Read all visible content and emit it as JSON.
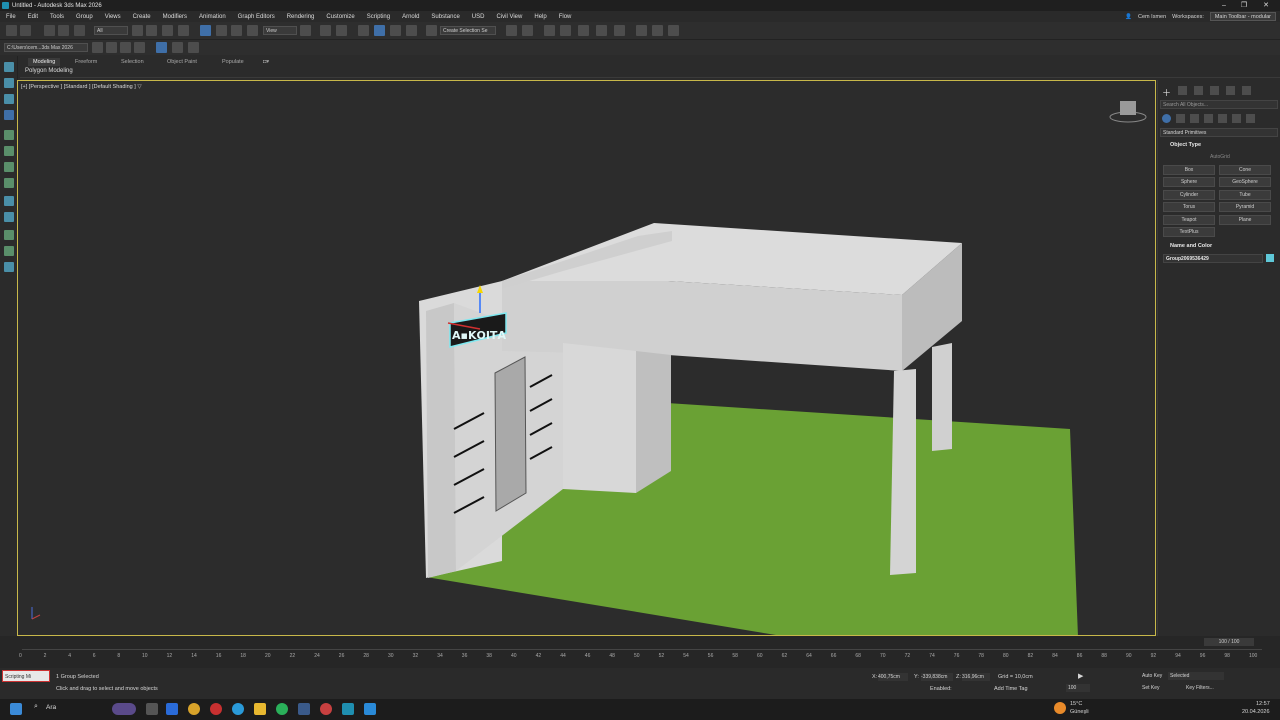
{
  "window": {
    "title": "Untitled - Autodesk 3ds Max 2026",
    "min": "–",
    "max": "❐",
    "close": "✕"
  },
  "menu": {
    "items": [
      "File",
      "Edit",
      "Tools",
      "Group",
      "Views",
      "Create",
      "Modifiers",
      "Animation",
      "Graph Editors",
      "Rendering",
      "Customize",
      "Scripting",
      "Arnold",
      "Substance",
      "USD",
      "Civil View",
      "Help",
      "Flow"
    ],
    "user": "Cem Ismen",
    "workspaces_label": "Workspaces:",
    "workspace_value": "Main Toolbar - modular"
  },
  "toolbar": {
    "filter_all": "All",
    "view_dropdown": "View",
    "selection_set": "Create Selection Se",
    "path": "C:\\Users\\cem...3ds Max 2026"
  },
  "ribbon": {
    "tabs": [
      "Modeling",
      "Freeform",
      "Selection",
      "Object Paint",
      "Populate"
    ],
    "sublabel": "Polygon Modeling"
  },
  "viewport": {
    "label": "[+] [Perspective ] [Standard ] [Default Shading ]",
    "filter_icon": "▽",
    "sign_text": "Α▪ΚΟΙΤΑ"
  },
  "command_panel": {
    "search_placeholder": "Search All Objects...",
    "category": "Standard Primitives",
    "object_type_header": "Object Type",
    "autogrid": "AutoGrid",
    "buttons": [
      "Box",
      "Cone",
      "Sphere",
      "GeoSphere",
      "Cylinder",
      "Tube",
      "Torus",
      "Pyramid",
      "Teapot",
      "Plane",
      "TextPlus"
    ],
    "name_color_header": "Name and Color",
    "object_name": "Group2069536429",
    "object_color": "#5fc8d8"
  },
  "timeline": {
    "frame_counter": "100 / 100",
    "ticks": [
      "0",
      "2",
      "4",
      "6",
      "8",
      "10",
      "12",
      "14",
      "16",
      "18",
      "20",
      "22",
      "24",
      "26",
      "28",
      "30",
      "32",
      "34",
      "36",
      "38",
      "40",
      "42",
      "44",
      "46",
      "48",
      "50",
      "52",
      "54",
      "56",
      "58",
      "60",
      "62",
      "64",
      "66",
      "68",
      "70",
      "72",
      "74",
      "76",
      "78",
      "80",
      "82",
      "84",
      "86",
      "88",
      "90",
      "92",
      "94",
      "96",
      "98",
      "100"
    ]
  },
  "status": {
    "maxscript": "Scripting Mi",
    "selected": "1 Group Selected",
    "prompt": "Click and drag to select and move objects",
    "x_label": "X:",
    "x_value": "400,75cm",
    "y_label": "Y:",
    "y_value": "-339,838cm",
    "z_label": "Z:",
    "z_value": "316,96cm",
    "grid": "Grid = 10,0cm",
    "enabled": "Enabled:",
    "add_time_tag": "Add Time Tag",
    "auto_key": "Auto Key",
    "set_key": "Set Key",
    "selected_dd": "Selected",
    "key_filters": "Key Filters...",
    "frame": "100"
  },
  "taskbar": {
    "search": "Ara",
    "weather_temp": "15°C",
    "weather_desc": "Güneşli",
    "time": "12:57",
    "date": "20.04.2026"
  },
  "colors": {
    "accent": "#4a90d9",
    "viewport_border": "#c8b84a",
    "ground": "#6aa134",
    "wall": "#d2d2d2"
  }
}
